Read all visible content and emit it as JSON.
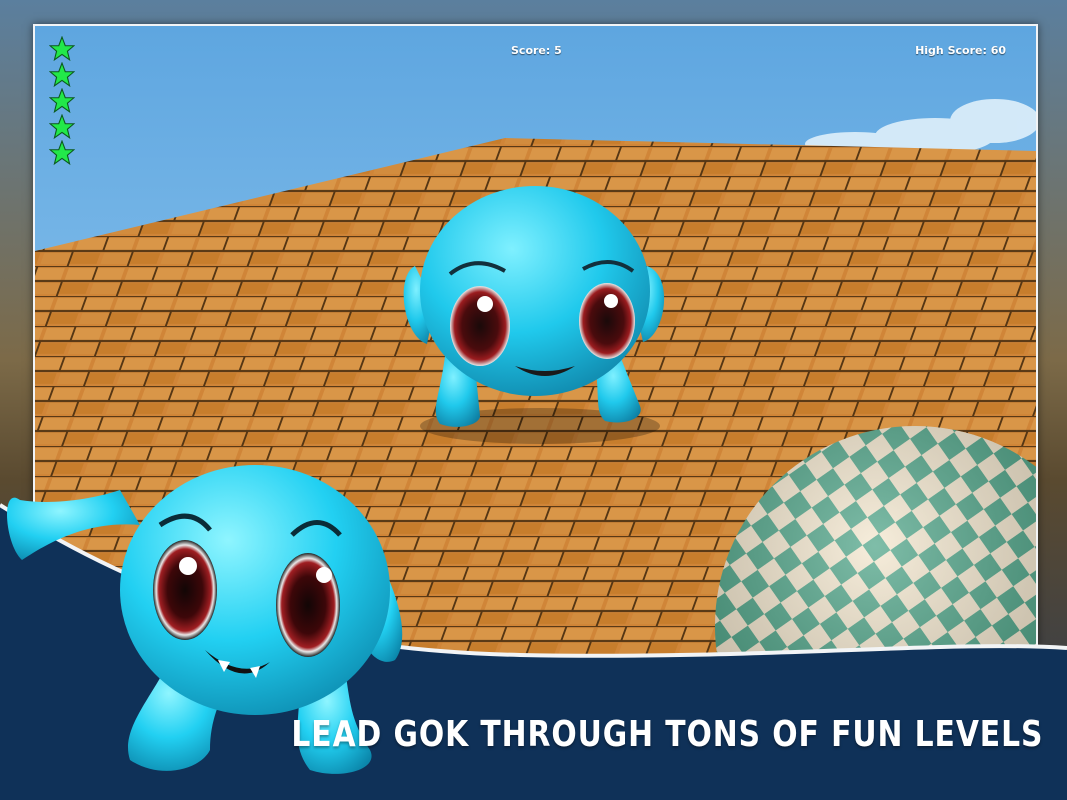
{
  "hud": {
    "score_label": "Score: 5",
    "high_score_label": "High Score: 60",
    "lives": 5
  },
  "caption": "LEAD GOK THROUGH TONS OF FUN LEVELS",
  "colors": {
    "sky": "#6fb0e4",
    "floor": "#d98c3a",
    "creature": "#2fcff0",
    "banner": "#0f3158",
    "star": "#22e84a"
  }
}
